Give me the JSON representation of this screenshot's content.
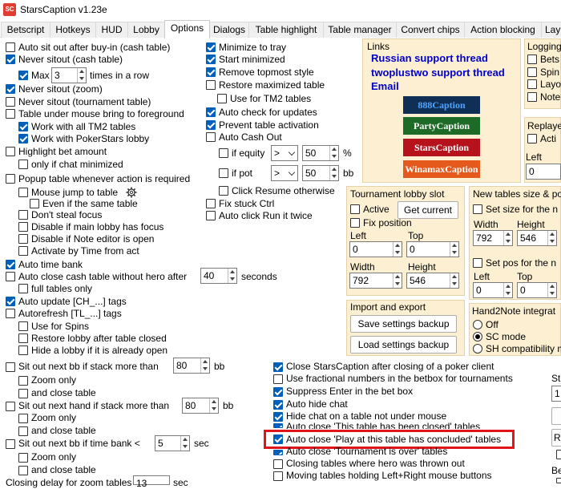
{
  "window": {
    "title": "StarsCaption v1.23e",
    "icon_text": "SC"
  },
  "tabs": [
    "Betscript",
    "Hotkeys",
    "HUD",
    "Lobby",
    "Options",
    "Dialogs",
    "Table highlight",
    "Table manager",
    "Convert chips",
    "Action blocking",
    "Lay"
  ],
  "active_tab": "Options",
  "col1": {
    "auto_sit_out": "Auto sit out after buy-in (cash table)",
    "never_sitout_cash": "Never sitout (cash table)",
    "max_label": "Max",
    "max_value": "3",
    "times_in_row": "times in a row",
    "never_sitout_zoom": "Never sitout (zoom)",
    "never_sitout_tournament": "Never sitout (tournament table)",
    "table_under_mouse": "Table under mouse bring to foreground",
    "work_tm2": "Work with all TM2 tables",
    "work_ps_lobby": "Work with PokerStars lobby",
    "highlight_bet": "Highlight bet amount",
    "only_chat_min": "only if chat minimized",
    "popup_table": "Popup table whenever action is required",
    "mouse_jump": "Mouse jump to table",
    "even_same_table": "Even if the same table",
    "dont_steal_focus": "Don't steal focus",
    "disable_main_lobby": "Disable if main lobby has focus",
    "disable_note_editor": "Disable if Note editor is open",
    "activate_by_time": "Activate by Time from act",
    "auto_time_bank": "Auto time bank",
    "auto_close_cash": "Auto close cash table without hero after",
    "auto_close_value": "40",
    "seconds": "seconds",
    "full_tables_only": "full tables only",
    "auto_update": "Auto update [CH_...] tags",
    "autorefresh": "Autorefresh [TL_...] tags",
    "use_for_spins": "Use for Spins",
    "restore_lobby": "Restore lobby after table closed",
    "hide_lobby": "Hide a lobby if it is already open",
    "sit_out_next_bb": "Sit out next bb if stack more than",
    "sit_out_bb_value": "80",
    "bb": "bb",
    "zoom_only": "Zoom only",
    "and_close_table": "and close table",
    "sit_out_next_hand": "Sit out next hand if stack more than",
    "sit_out_hand_value": "80",
    "sit_out_time_bank": "Sit out next bb if time bank <",
    "time_bank_value": "5",
    "sec": "sec",
    "closing_delay": "Closing delay for zoom tables",
    "closing_delay_value": "13",
    "closing_delay_unit": "sec"
  },
  "col2": {
    "minimize_tray": "Minimize to tray",
    "start_minimized": "Start minimized",
    "remove_topmost": "Remove topmost style",
    "restore_maximized": "Restore maximized table",
    "use_tm2": "Use for TM2 tables",
    "auto_check_updates": "Auto check for updates",
    "prevent_activation": "Prevent table activation",
    "auto_cash_out": "Auto Cash Out",
    "if_equity": "if equity",
    "equity_op": ">",
    "equity_value": "50",
    "percent": "%",
    "if_pot": "if pot",
    "pot_op": ">",
    "pot_value": "50",
    "pot_unit": "bb",
    "click_resume": "Click Resume otherwise",
    "fix_stuck_ctrl": "Fix stuck Ctrl",
    "auto_click_run": "Auto click Run it twice"
  },
  "links": {
    "title": "Links",
    "items": [
      "Russian support thread",
      "twoplustwo support thread",
      "Email"
    ],
    "logos": [
      {
        "text": "888Caption",
        "bg": "#0f2f55",
        "fg": "#4fa3ff"
      },
      {
        "text": "PartyCaption",
        "bg": "#1e6a27",
        "fg": "#ffffff"
      },
      {
        "text": "StarsCaption",
        "bg": "#b5121b",
        "fg": "#ffffff"
      },
      {
        "text": "WinamaxCaption",
        "bg": "#e55a1c",
        "fg": "#ffffff"
      }
    ]
  },
  "logging": {
    "title": "Logging",
    "items": [
      "Bets",
      "Spin",
      "Layo",
      "Note"
    ]
  },
  "replayer": {
    "title": "Replaye",
    "active": "Acti",
    "left": "Left",
    "left_value": "0"
  },
  "tournament_lobby": {
    "title": "Tournament lobby slot",
    "active": "Active",
    "get_current": "Get current",
    "fix_position": "Fix position",
    "left": "Left",
    "top": "Top",
    "left_value": "0",
    "top_value": "0",
    "width": "Width",
    "height": "Height",
    "width_value": "792",
    "height_value": "546"
  },
  "new_tables": {
    "title": "New tables size & po",
    "set_size": "Set size for the n",
    "width": "Width",
    "height": "Height",
    "width_value": "792",
    "height_value": "546",
    "set_pos": "Set pos for the n",
    "left": "Left",
    "top": "Top",
    "left_value": "0",
    "top_value": "0"
  },
  "import_export": {
    "title": "Import and export",
    "save": "Save settings backup",
    "load": "Load settings backup"
  },
  "hand2note": {
    "title": "Hand2Note integrat",
    "off": "Off",
    "sc_mode": "SC mode",
    "sh_mode": "SH compatibility m"
  },
  "bottom_mid": {
    "close_sc": "Close StarsCaption after closing of a poker client",
    "fractional": "Use fractional numbers in the betbox for tournaments",
    "suppress_enter": "Suppress Enter in the bet box",
    "auto_hide_chat": "Auto hide chat",
    "hide_chat": "Hide chat on a table not under mouse",
    "auto_close_closed": "Auto close 'This table has been closed' tables",
    "auto_close_concluded": "Auto close 'Play at this table has concluded' tables",
    "auto_close_tournament": "Auto close 'Tournament is over' tables",
    "closing_thrown_out": "Closing tables where hero was thrown out",
    "moving_tables": "Moving tables holding Left+Right mouse buttons"
  },
  "right_edge": {
    "st": "St",
    "one": "1",
    "r": "R",
    "be": "Be"
  }
}
